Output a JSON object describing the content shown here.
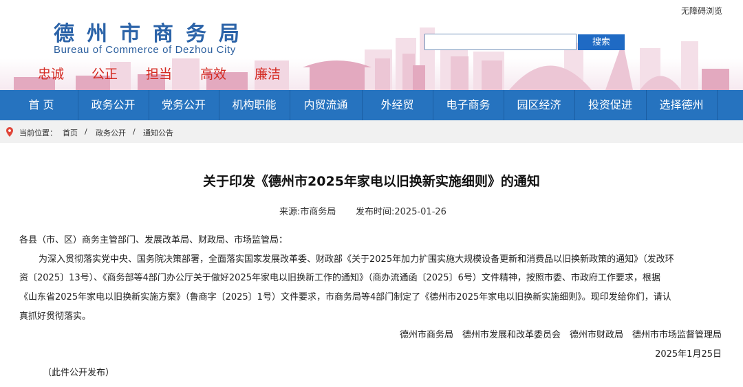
{
  "header": {
    "site_title": "德州市商务局",
    "site_subtitle": "Bureau of Commerce of Dezhou City",
    "motto": [
      "忠诚",
      "公正",
      "担当",
      "高效",
      "廉洁"
    ],
    "accessibility_link": "无障碍浏览",
    "search_placeholder": "",
    "search_button": "搜索",
    "accent_color": "#2673bf",
    "motto_color": "#d42a22"
  },
  "nav": {
    "items": [
      "首 页",
      "政务公开",
      "党务公开",
      "机构职能",
      "内贸流通",
      "外经贸",
      "电子商务",
      "园区经济",
      "投资促进",
      "选择德州"
    ]
  },
  "breadcrumb": {
    "icon": "location-pin-icon",
    "prefix": "当前位置：",
    "items": [
      "首页",
      "政务公开",
      "通知公告"
    ],
    "separator": "/"
  },
  "article": {
    "title": "关于印发《德州市2025年家电以旧换新实施细则》的通知",
    "source": "来源:市商务局",
    "published": "发布时间:2025-01-26",
    "salutation": "各县（市、区）商务主管部门、发展改革局、财政局、市场监管局：",
    "paragraph_lines": [
      "为深入贯彻落实党中央、国务院决策部署，全面落实国家发展改革委、财政部《关于2025年加力扩围实施大规模设备更新和消费品以旧换新政策的通知》（发改环",
      "资〔2025〕13号）、《商务部等4部门办公厅关于做好2025年家电以旧换新工作的通知》（商办流通函〔2025〕6号）文件精神，按照市委、市政府工作要求，根据",
      "《山东省2025年家电以旧换新实施方案》（鲁商字〔2025〕1号）文件要求，市商务局等4部门制定了《德州市2025年家电以旧换新实施细则》。现印发给你们，请认",
      "真抓好贯彻落实。"
    ],
    "signatories": "德州市商务局　德州市发展和改革委员会　德州市财政局　德州市市场监督管理局",
    "date": "2025年1月25日",
    "note": "（此件公开发布）"
  }
}
